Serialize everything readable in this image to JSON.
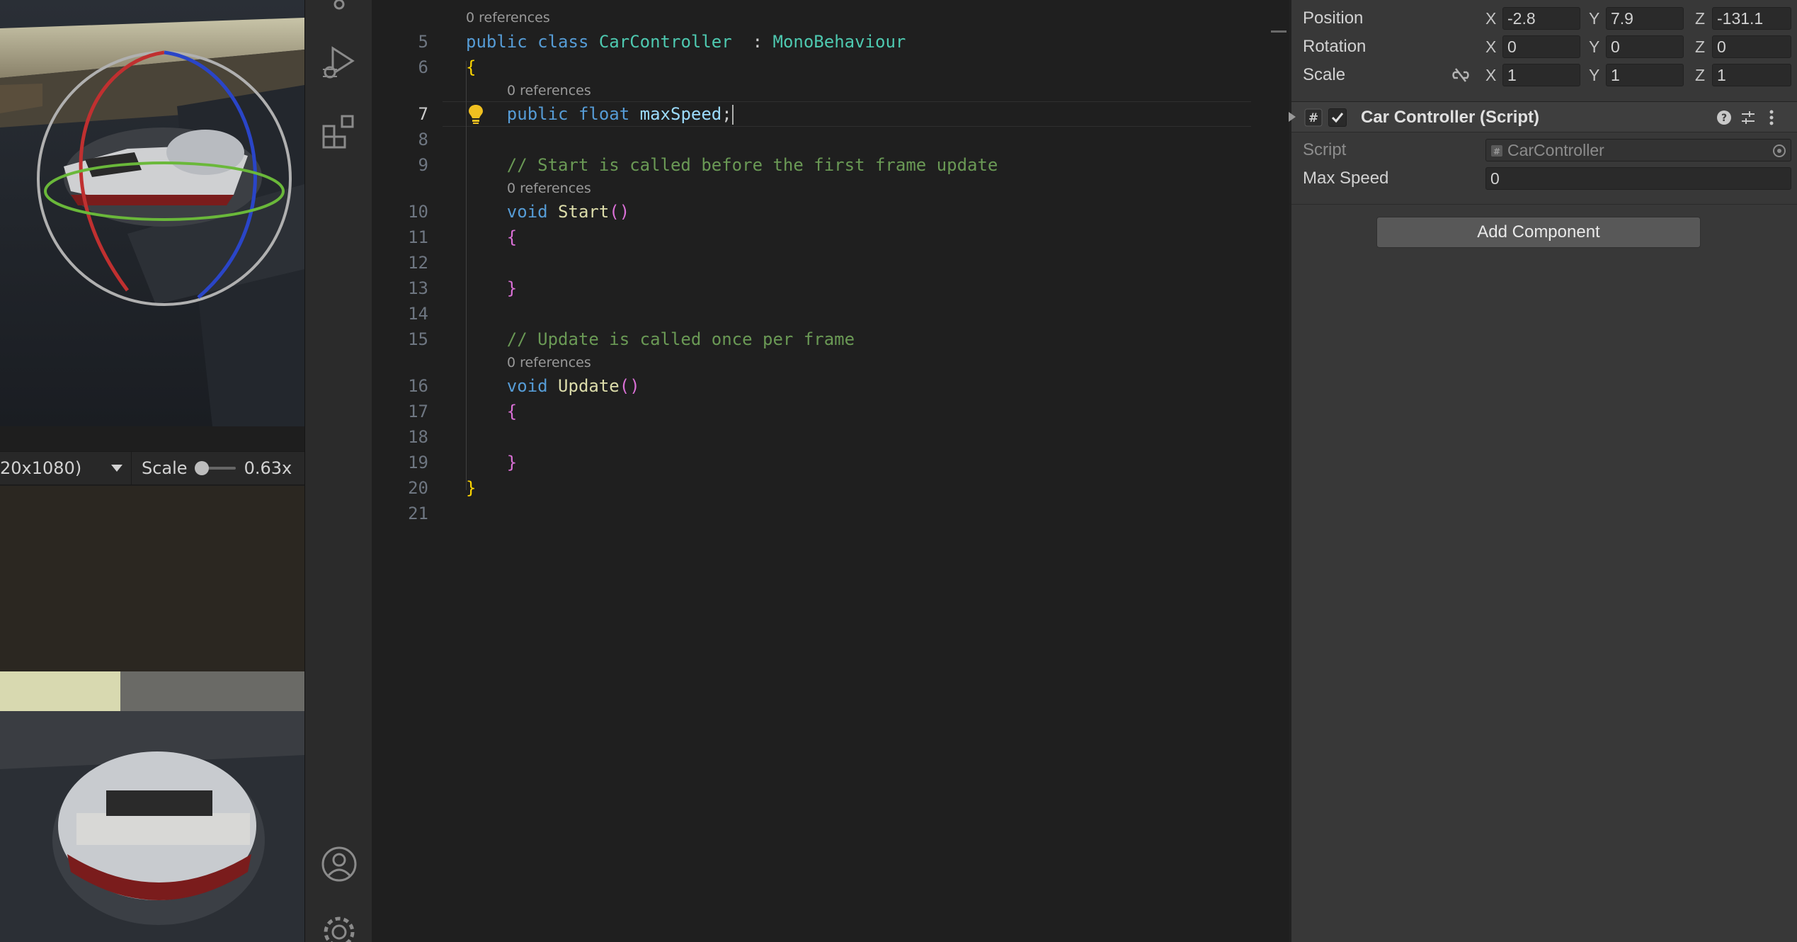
{
  "game_toolbar": {
    "resolution": "20x1080)",
    "scale_label": "Scale",
    "scale_value": "0.63x",
    "scale_fraction": 0.0
  },
  "activity_bar": {
    "icons": [
      "source-control-icon",
      "run-debug-icon",
      "extensions-icon",
      "account-icon",
      "settings-icon"
    ]
  },
  "editor": {
    "lens_class": "0 references",
    "lens_field": "0 references",
    "lens_start": "0 references",
    "lens_update": "0 references",
    "lines": [
      {
        "n": "5",
        "code": [
          [
            "kw",
            "public "
          ],
          [
            "kw",
            "class "
          ],
          [
            "ty",
            "CarController"
          ],
          [
            "",
            "  : "
          ],
          [
            "ty",
            "MonoBehaviour"
          ]
        ]
      },
      {
        "n": "6",
        "code": [
          [
            "br1",
            "{"
          ]
        ]
      },
      {
        "n": "7",
        "code": [
          [
            "",
            "    "
          ],
          [
            "kw",
            "public "
          ],
          [
            "kw",
            "float "
          ],
          [
            "id",
            "maxSpeed"
          ],
          [
            "",
            ";"
          ]
        ]
      },
      {
        "n": "8",
        "code": []
      },
      {
        "n": "9",
        "code": [
          [
            "",
            "    "
          ],
          [
            "cm",
            "// Start is called before the first frame update"
          ]
        ]
      },
      {
        "n": "10",
        "code": [
          [
            "",
            "    "
          ],
          [
            "kw",
            "void "
          ],
          [
            "fn",
            "Start"
          ],
          [
            "br2",
            "()"
          ]
        ]
      },
      {
        "n": "11",
        "code": [
          [
            "",
            "    "
          ],
          [
            "br2",
            "{"
          ]
        ]
      },
      {
        "n": "12",
        "code": []
      },
      {
        "n": "13",
        "code": [
          [
            "",
            "    "
          ],
          [
            "br2",
            "}"
          ]
        ]
      },
      {
        "n": "14",
        "code": []
      },
      {
        "n": "15",
        "code": [
          [
            "",
            "    "
          ],
          [
            "cm",
            "// Update is called once per frame"
          ]
        ]
      },
      {
        "n": "16",
        "code": [
          [
            "",
            "    "
          ],
          [
            "kw",
            "void "
          ],
          [
            "fn",
            "Update"
          ],
          [
            "br2",
            "()"
          ]
        ]
      },
      {
        "n": "17",
        "code": [
          [
            "",
            "    "
          ],
          [
            "br2",
            "{"
          ]
        ]
      },
      {
        "n": "18",
        "code": []
      },
      {
        "n": "19",
        "code": [
          [
            "",
            "    "
          ],
          [
            "br2",
            "}"
          ]
        ]
      },
      {
        "n": "20",
        "code": [
          [
            "br1",
            "}"
          ]
        ]
      },
      {
        "n": "21",
        "code": []
      }
    ]
  },
  "inspector": {
    "transform": {
      "position_label": "Position",
      "rotation_label": "Rotation",
      "scale_label": "Scale",
      "x": "X",
      "y": "Y",
      "z": "Z",
      "position": {
        "x": "-2.8",
        "y": "7.9",
        "z": "-131.1"
      },
      "rotation": {
        "x": "0",
        "y": "0",
        "z": "0"
      },
      "scale": {
        "x": "1",
        "y": "1",
        "z": "1"
      }
    },
    "component": {
      "title": "Car Controller (Script)",
      "enabled": true,
      "script_label": "Script",
      "script_value": "CarController",
      "max_speed_label": "Max Speed",
      "max_speed_value": "0"
    },
    "add_component_label": "Add Component"
  }
}
